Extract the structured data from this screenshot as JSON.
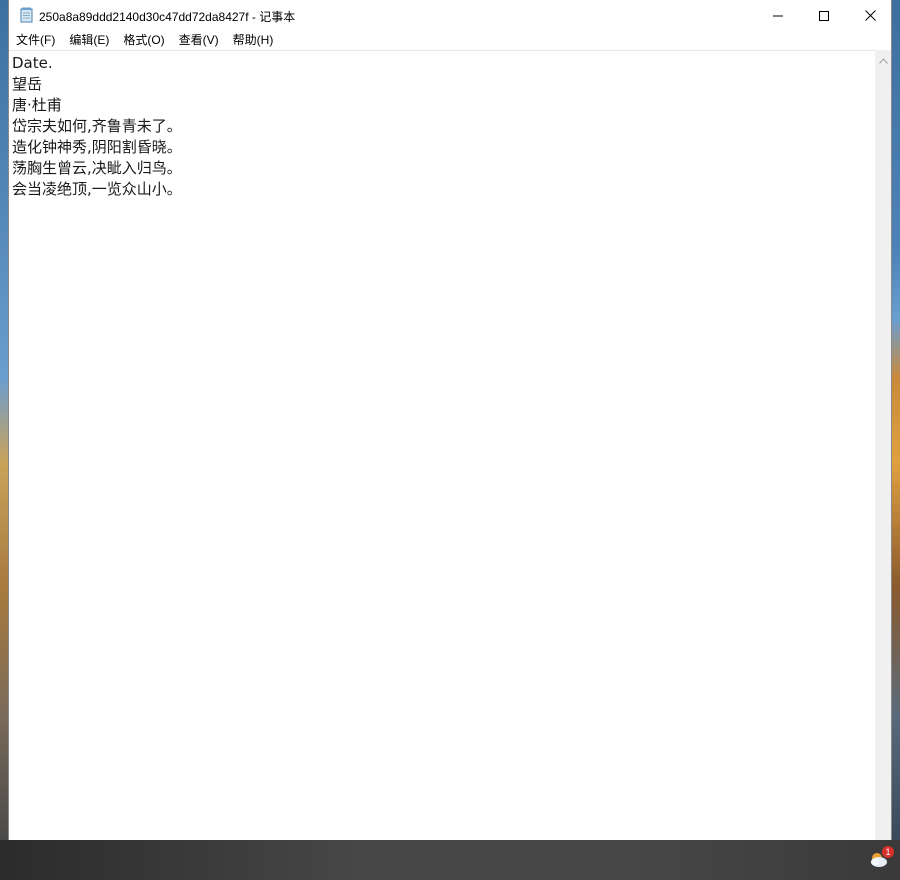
{
  "window": {
    "title": "250a8a89ddd2140d30c47dd72da8427f - 记事本",
    "app_icon": "notepad-icon",
    "controls": {
      "minimize_icon": "minimize-icon",
      "maximize_icon": "maximize-icon",
      "close_icon": "close-icon"
    }
  },
  "menu": {
    "items": [
      {
        "label": "文件(F)"
      },
      {
        "label": "编辑(E)"
      },
      {
        "label": "格式(O)"
      },
      {
        "label": "查看(V)"
      },
      {
        "label": "帮助(H)"
      }
    ]
  },
  "document": {
    "lines": [
      "Date.",
      "望岳",
      "唐·杜甫",
      "岱宗夫如何,齐鲁青未了。",
      "造化钟神秀,阴阳割昏晓。",
      "荡胸生曾云,决眦入归鸟。",
      "会当凌绝顶,一览众山小。"
    ]
  },
  "taskbar": {
    "tray_icon": "weather-notification-icon",
    "badge_count": "1"
  },
  "colors": {
    "window_bg": "#ffffff",
    "taskbar_bg": "#474747",
    "scrollbar_bg": "#f0f0f0",
    "badge_red": "#d9302a"
  }
}
